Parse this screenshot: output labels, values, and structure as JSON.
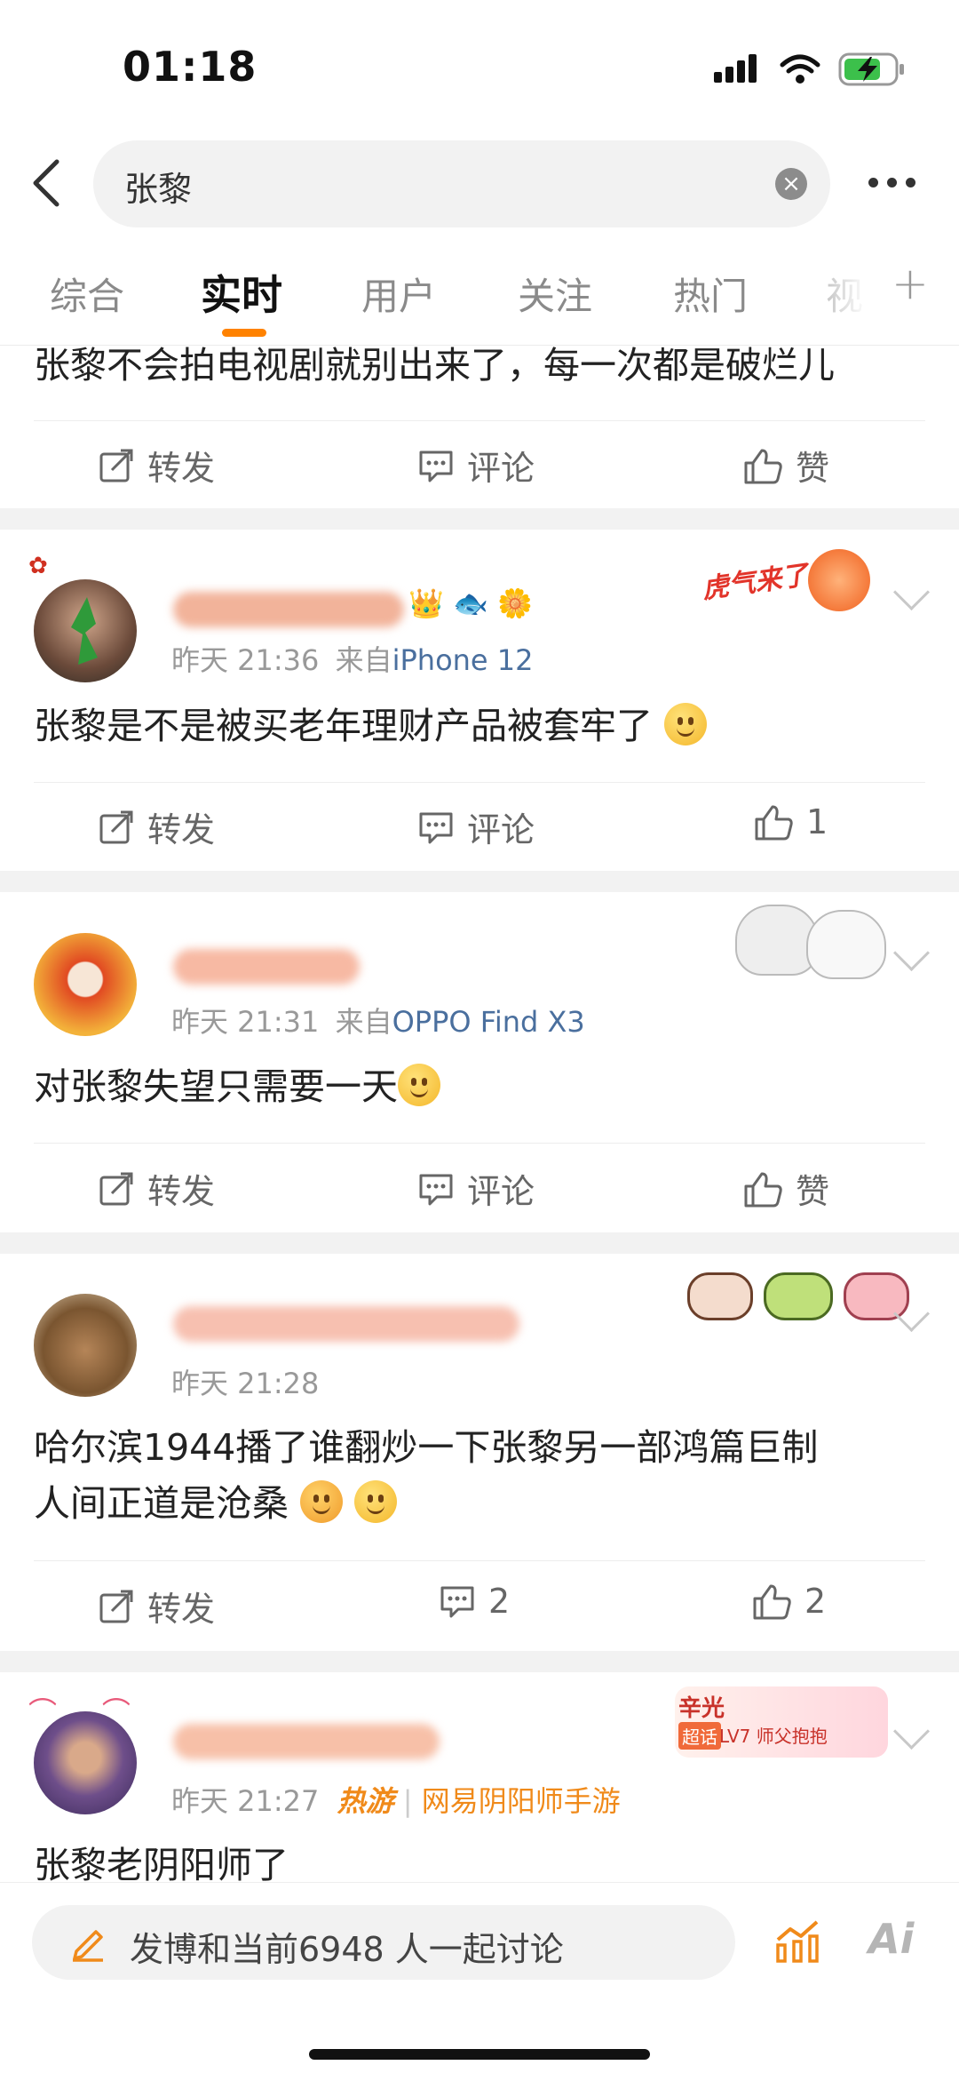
{
  "status_bar": {
    "time": "01:18"
  },
  "search": {
    "query": "张黎"
  },
  "tabs": [
    {
      "label": "综合"
    },
    {
      "label": "实时"
    },
    {
      "label": "用户"
    },
    {
      "label": "关注"
    },
    {
      "label": "热门"
    },
    {
      "label": "视"
    }
  ],
  "active_tab": "实时",
  "actions": {
    "repost": "转发",
    "comment": "评论",
    "like": "赞"
  },
  "posts": [
    {
      "text": "张黎不会拍电视剧就别出来了，每一次都是破烂儿",
      "comment_count": "",
      "like_count": ""
    },
    {
      "time": "昨天 21:36",
      "from_label": "来自",
      "source": "iPhone 12",
      "text": "张黎是不是被买老年理财产品被套牢了",
      "badge_text": "虎气来了",
      "like_count": "1"
    },
    {
      "time": "昨天 21:31",
      "from_label": "来自",
      "source": "OPPO Find X3",
      "text": "对张黎失望只需要一天"
    },
    {
      "time": "昨天 21:28",
      "text_line1": "哈尔滨1944播了谁翻炒一下张黎另一部鸿篇巨制",
      "text_line2": "人间正道是沧桑",
      "comment_count": "2",
      "like_count": "2"
    },
    {
      "time": "昨天 21:27",
      "source_tag": "热游",
      "source": "网易阴阳师手游",
      "text": "张黎老阴阳师了",
      "badge_name": "辛光",
      "badge_tag": "超话",
      "badge_level": "LV7 师父抱抱"
    }
  ],
  "compose": {
    "placeholder": "发博和当前6948 人一起讨论"
  },
  "colors": {
    "accent": "#ff8200",
    "link": "#4a6f9e",
    "background": "#ffffff",
    "separator": "#f2f2f2"
  },
  "icons": [
    "back-icon",
    "clear-icon",
    "more-icon",
    "plus-icon",
    "repost-icon",
    "comment-icon",
    "like-icon",
    "edit-icon",
    "chart-icon",
    "ai-icon",
    "chevron-down-icon"
  ]
}
